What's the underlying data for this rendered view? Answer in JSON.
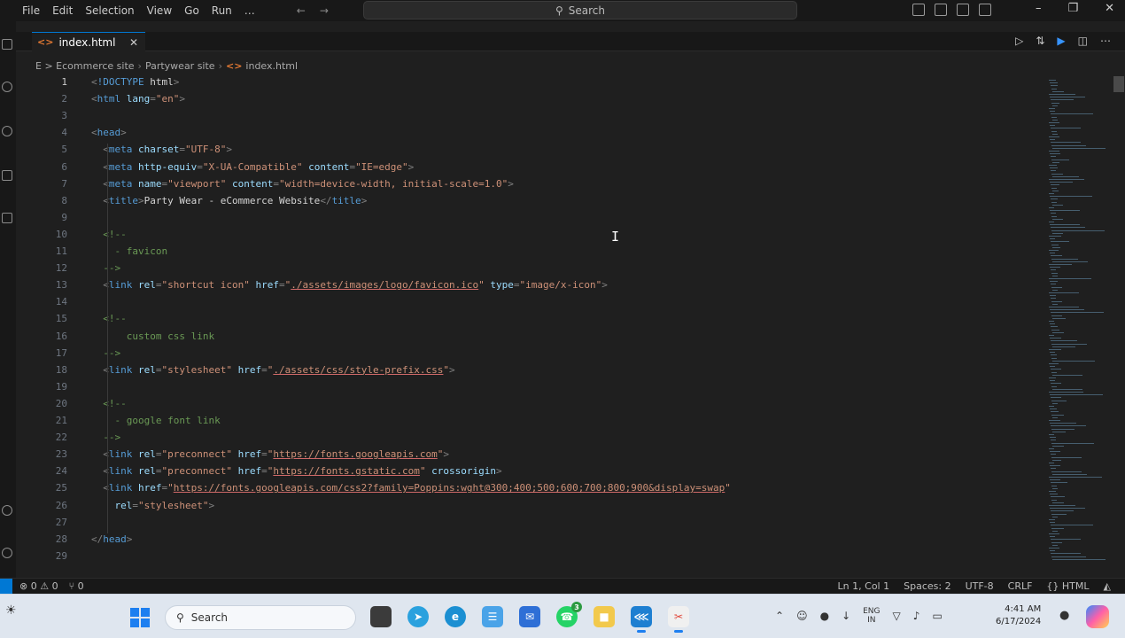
{
  "menu": [
    "File",
    "Edit",
    "Selection",
    "View",
    "Go",
    "Run",
    "…"
  ],
  "search": {
    "label": "Search"
  },
  "tab": {
    "name": "index.html"
  },
  "breadcrumb": [
    "E > Ecommerce site",
    "Partywear site",
    "index.html"
  ],
  "editor": {
    "lines": [
      {
        "n": "1",
        "parts": [
          [
            "punc",
            "<"
          ],
          [
            "tag",
            "!DOCTYPE"
          ],
          [
            "txt",
            " html"
          ],
          [
            "punc",
            ">"
          ]
        ]
      },
      {
        "n": "2",
        "parts": [
          [
            "punc",
            "<"
          ],
          [
            "tag",
            "html"
          ],
          [
            "attr",
            " lang"
          ],
          [
            "punc",
            "="
          ],
          [
            "str",
            "\"en\""
          ],
          [
            "punc",
            ">"
          ]
        ]
      },
      {
        "n": "3",
        "parts": []
      },
      {
        "n": "4",
        "parts": [
          [
            "punc",
            "<"
          ],
          [
            "tag",
            "head"
          ],
          [
            "punc",
            ">"
          ]
        ]
      },
      {
        "n": "5",
        "parts": [
          [
            "txt",
            "  "
          ],
          [
            "punc",
            "<"
          ],
          [
            "tag",
            "meta"
          ],
          [
            "attr",
            " charset"
          ],
          [
            "punc",
            "="
          ],
          [
            "str",
            "\"UTF-8\""
          ],
          [
            "punc",
            ">"
          ]
        ]
      },
      {
        "n": "6",
        "parts": [
          [
            "txt",
            "  "
          ],
          [
            "punc",
            "<"
          ],
          [
            "tag",
            "meta"
          ],
          [
            "attr",
            " http-equiv"
          ],
          [
            "punc",
            "="
          ],
          [
            "str",
            "\"X-UA-Compatible\""
          ],
          [
            "attr",
            " content"
          ],
          [
            "punc",
            "="
          ],
          [
            "str",
            "\"IE=edge\""
          ],
          [
            "punc",
            ">"
          ]
        ]
      },
      {
        "n": "7",
        "parts": [
          [
            "txt",
            "  "
          ],
          [
            "punc",
            "<"
          ],
          [
            "tag",
            "meta"
          ],
          [
            "attr",
            " name"
          ],
          [
            "punc",
            "="
          ],
          [
            "str",
            "\"viewport\""
          ],
          [
            "attr",
            " content"
          ],
          [
            "punc",
            "="
          ],
          [
            "str",
            "\"width=device-width, initial-scale=1.0\""
          ],
          [
            "punc",
            ">"
          ]
        ]
      },
      {
        "n": "8",
        "parts": [
          [
            "txt",
            "  "
          ],
          [
            "punc",
            "<"
          ],
          [
            "tag",
            "title"
          ],
          [
            "punc",
            ">"
          ],
          [
            "txt",
            "Party Wear - eCommerce Website"
          ],
          [
            "punc",
            "</"
          ],
          [
            "tag",
            "title"
          ],
          [
            "punc",
            ">"
          ]
        ]
      },
      {
        "n": "9",
        "parts": []
      },
      {
        "n": "10",
        "parts": [
          [
            "txt",
            "  "
          ],
          [
            "cmt",
            "<!--"
          ]
        ]
      },
      {
        "n": "11",
        "parts": [
          [
            "txt",
            "  "
          ],
          [
            "cmt",
            "  - favicon"
          ]
        ]
      },
      {
        "n": "12",
        "parts": [
          [
            "txt",
            "  "
          ],
          [
            "cmt",
            "-->"
          ]
        ]
      },
      {
        "n": "13",
        "parts": [
          [
            "txt",
            "  "
          ],
          [
            "punc",
            "<"
          ],
          [
            "tag",
            "link"
          ],
          [
            "attr",
            " rel"
          ],
          [
            "punc",
            "="
          ],
          [
            "str",
            "\"shortcut icon\""
          ],
          [
            "attr",
            " href"
          ],
          [
            "punc",
            "="
          ],
          [
            "str",
            "\""
          ],
          [
            "link",
            "./assets/images/logo/favicon.ico"
          ],
          [
            "str",
            "\""
          ],
          [
            "attr",
            " type"
          ],
          [
            "punc",
            "="
          ],
          [
            "str",
            "\"image/x-icon\""
          ],
          [
            "punc",
            ">"
          ]
        ]
      },
      {
        "n": "14",
        "parts": []
      },
      {
        "n": "15",
        "parts": [
          [
            "txt",
            "  "
          ],
          [
            "cmt",
            "<!--"
          ]
        ]
      },
      {
        "n": "16",
        "parts": [
          [
            "txt",
            "  "
          ],
          [
            "cmt",
            "    custom css link"
          ]
        ]
      },
      {
        "n": "17",
        "parts": [
          [
            "txt",
            "  "
          ],
          [
            "cmt",
            "-->"
          ]
        ]
      },
      {
        "n": "18",
        "parts": [
          [
            "txt",
            "  "
          ],
          [
            "punc",
            "<"
          ],
          [
            "tag",
            "link"
          ],
          [
            "attr",
            " rel"
          ],
          [
            "punc",
            "="
          ],
          [
            "str",
            "\"stylesheet\""
          ],
          [
            "attr",
            " href"
          ],
          [
            "punc",
            "="
          ],
          [
            "str",
            "\""
          ],
          [
            "link",
            "./assets/css/style-prefix.css"
          ],
          [
            "str",
            "\""
          ],
          [
            "punc",
            ">"
          ]
        ]
      },
      {
        "n": "19",
        "parts": []
      },
      {
        "n": "20",
        "parts": [
          [
            "txt",
            "  "
          ],
          [
            "cmt",
            "<!--"
          ]
        ]
      },
      {
        "n": "21",
        "parts": [
          [
            "txt",
            "  "
          ],
          [
            "cmt",
            "  - google font link"
          ]
        ]
      },
      {
        "n": "22",
        "parts": [
          [
            "txt",
            "  "
          ],
          [
            "cmt",
            "-->"
          ]
        ]
      },
      {
        "n": "23",
        "parts": [
          [
            "txt",
            "  "
          ],
          [
            "punc",
            "<"
          ],
          [
            "tag",
            "link"
          ],
          [
            "attr",
            " rel"
          ],
          [
            "punc",
            "="
          ],
          [
            "str",
            "\"preconnect\""
          ],
          [
            "attr",
            " href"
          ],
          [
            "punc",
            "="
          ],
          [
            "str",
            "\""
          ],
          [
            "link",
            "https://fonts.googleapis.com"
          ],
          [
            "str",
            "\""
          ],
          [
            "punc",
            ">"
          ]
        ]
      },
      {
        "n": "24",
        "parts": [
          [
            "txt",
            "  "
          ],
          [
            "punc",
            "<"
          ],
          [
            "tag",
            "link"
          ],
          [
            "attr",
            " rel"
          ],
          [
            "punc",
            "="
          ],
          [
            "str",
            "\"preconnect\""
          ],
          [
            "attr",
            " href"
          ],
          [
            "punc",
            "="
          ],
          [
            "str",
            "\""
          ],
          [
            "link",
            "https://fonts.gstatic.com"
          ],
          [
            "str",
            "\""
          ],
          [
            "attr",
            " crossorigin"
          ],
          [
            "punc",
            ">"
          ]
        ]
      },
      {
        "n": "25",
        "parts": [
          [
            "txt",
            "  "
          ],
          [
            "punc",
            "<"
          ],
          [
            "tag",
            "link"
          ],
          [
            "attr",
            " href"
          ],
          [
            "punc",
            "="
          ],
          [
            "str",
            "\""
          ],
          [
            "link",
            "https://fonts.googleapis.com/css2?family=Poppins:wght@300;400;500;600;700;800;900&display=swap"
          ],
          [
            "str",
            "\""
          ]
        ]
      },
      {
        "n": "26",
        "parts": [
          [
            "txt",
            "    "
          ],
          [
            "attr",
            "rel"
          ],
          [
            "punc",
            "="
          ],
          [
            "str",
            "\"stylesheet\""
          ],
          [
            "punc",
            ">"
          ]
        ]
      },
      {
        "n": "27",
        "parts": []
      },
      {
        "n": "28",
        "parts": [
          [
            "punc",
            "</"
          ],
          [
            "tag",
            "head"
          ],
          [
            "punc",
            ">"
          ]
        ]
      },
      {
        "n": "29",
        "parts": []
      }
    ]
  },
  "status": {
    "left": [
      "⊗ 0 ⚠ 0",
      "⑂ 0"
    ],
    "right": [
      "Ln 1, Col 1",
      "Spaces: 2",
      "UTF-8",
      "CRLF",
      "{} HTML"
    ]
  },
  "taskbar": {
    "search_label": "Search",
    "lang": [
      "ENG",
      "IN"
    ],
    "time": "4:41 AM",
    "date": "6/17/2024",
    "whatsapp_badge": "3"
  },
  "colors": {
    "accent": "#0078d4",
    "editor_bg": "#1f1f1f",
    "html_icon": "#e37933"
  }
}
